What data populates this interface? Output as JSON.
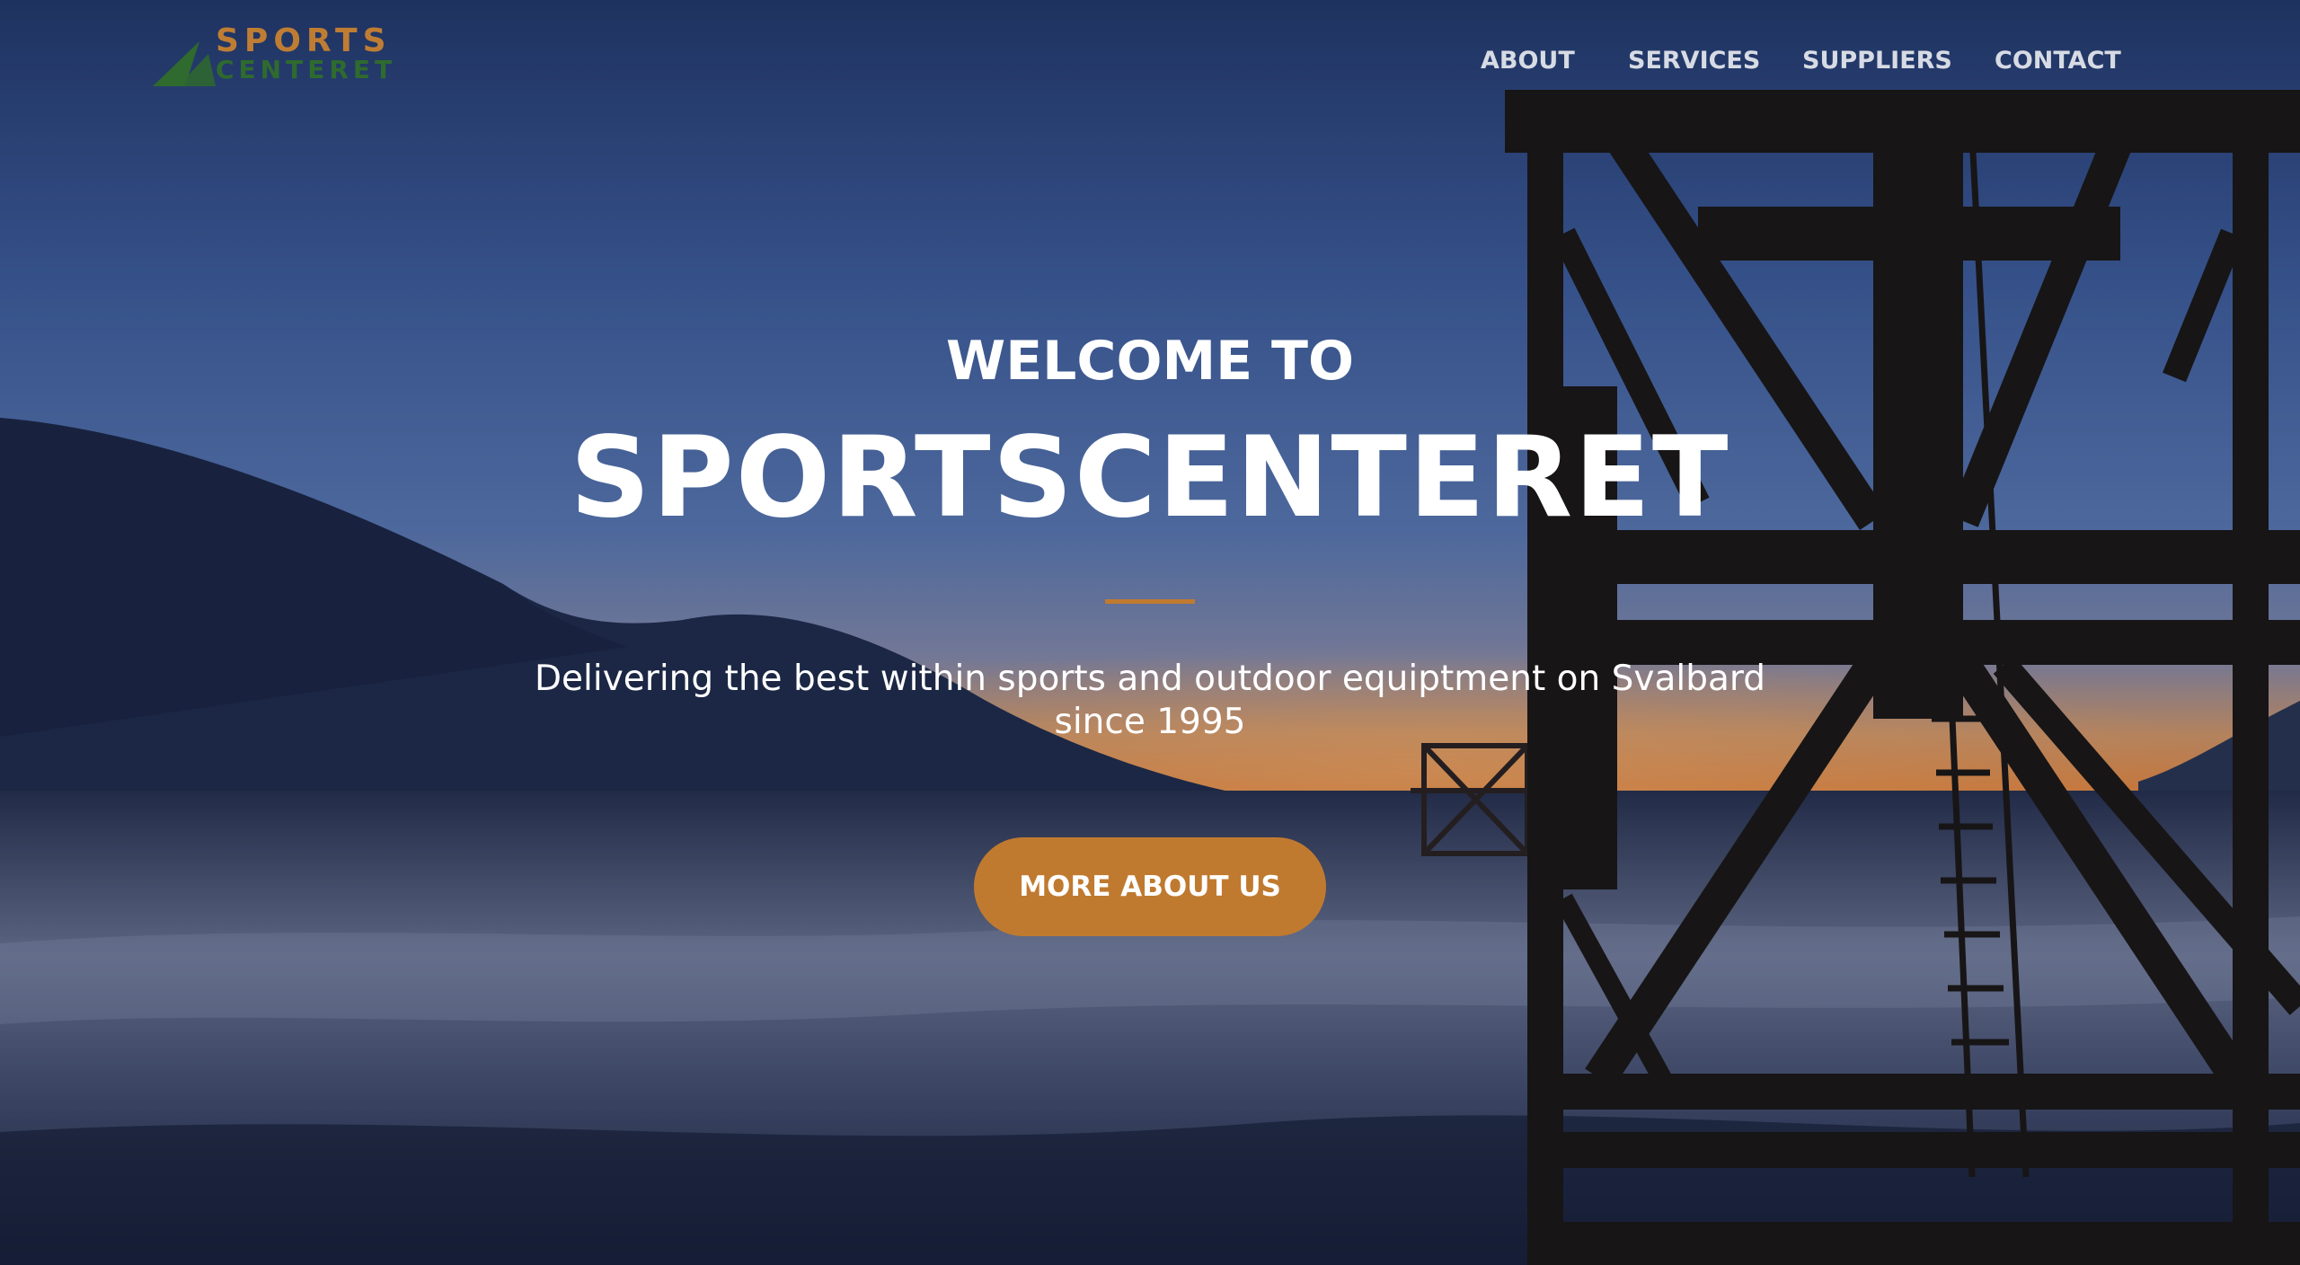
{
  "brand": {
    "line1": "SPORTS",
    "line2": "CENTERET",
    "primary_color": "#bf7d33",
    "secondary_color": "#2f6a2e"
  },
  "nav": {
    "items": [
      {
        "label": "ABOUT"
      },
      {
        "label": "SERVICES"
      },
      {
        "label": "SUPPLIERS"
      },
      {
        "label": "CONTACT"
      }
    ]
  },
  "hero": {
    "welcome": "WELCOME TO",
    "title": "SPORTSCENTERET",
    "tagline": "Delivering the best within sports and outdoor equiptment on Svalbard since 1995",
    "cta_label": "MORE ABOUT US",
    "accent_color": "#c07a2f"
  }
}
